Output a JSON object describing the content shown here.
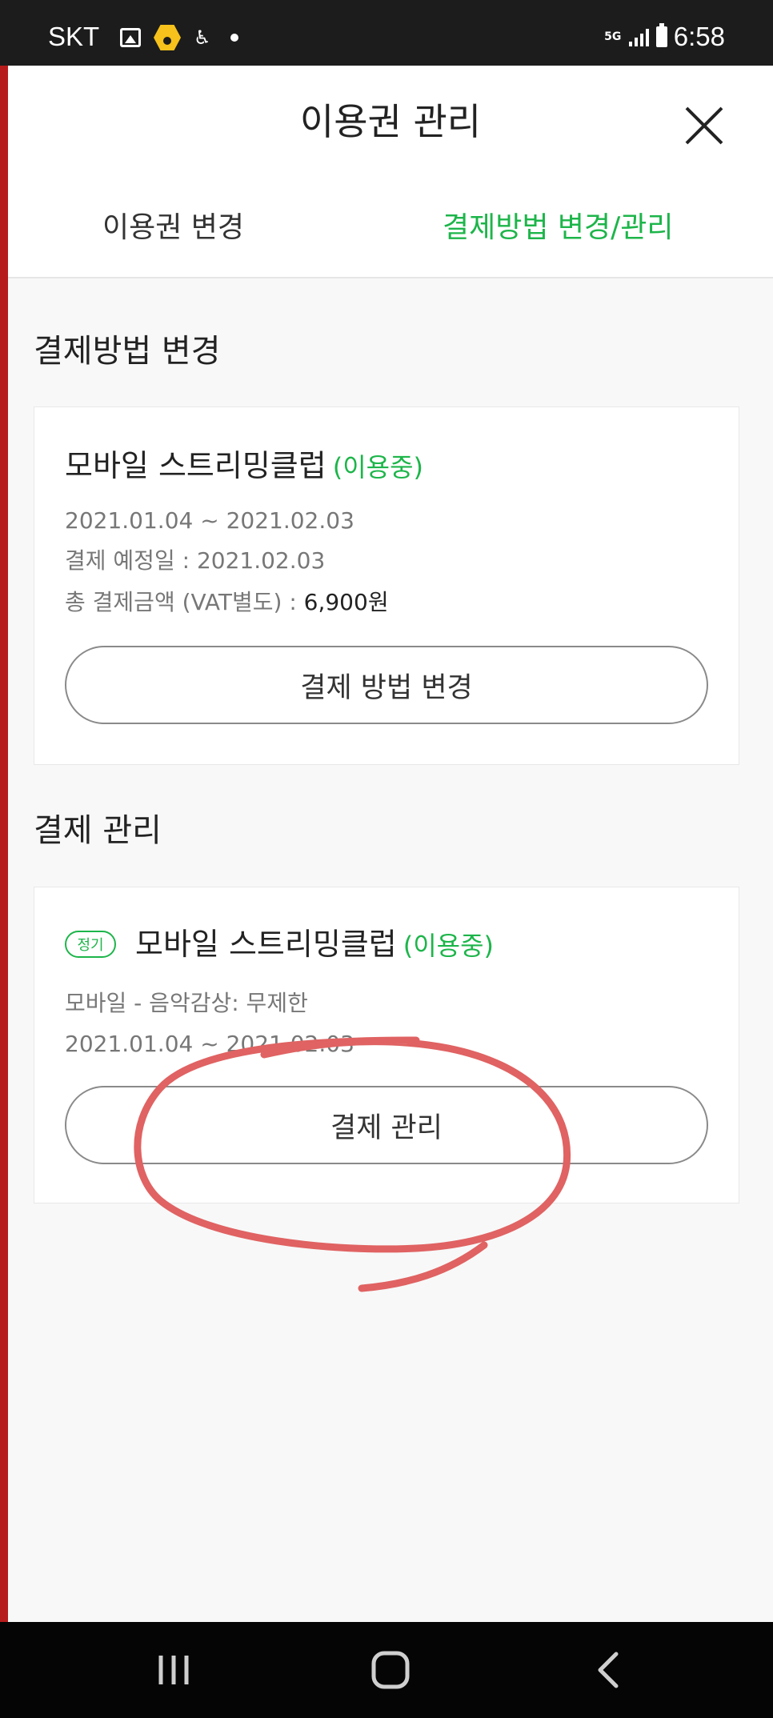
{
  "status_bar": {
    "carrier": "SKT",
    "network": "5G",
    "time": "6:58"
  },
  "header": {
    "title": "이용권 관리",
    "close_icon": "close-icon"
  },
  "tabs": [
    {
      "label": "이용권 변경",
      "active": false
    },
    {
      "label": "결제방법 변경/관리",
      "active": true
    }
  ],
  "colors": {
    "accent": "#1db54a",
    "annotation": "#e06262"
  },
  "payment_method": {
    "section_title": "결제방법 변경",
    "product": "모바일 스트리밍클럽",
    "status": "(이용중)",
    "period": "2021.01.04 ~ 2021.02.03",
    "next_payment_label": "결제 예정일 : ",
    "next_payment_date": "2021.02.03",
    "total_label": "총 결제금액 (VAT별도) : ",
    "total_amount": "6,900원",
    "button_label": "결제 방법 변경"
  },
  "payment_manage": {
    "section_title": "결제 관리",
    "badge": "정기",
    "product": "모바일 스트리밍클럽",
    "status": "(이용중)",
    "detail": "모바일 - 음악감상: 무제한",
    "period": "2021.01.04 ~ 2021.02.03",
    "button_label": "결제 관리"
  },
  "nav": {
    "recents_icon": "recents-icon",
    "home_icon": "home-icon",
    "back_icon": "back-icon"
  }
}
